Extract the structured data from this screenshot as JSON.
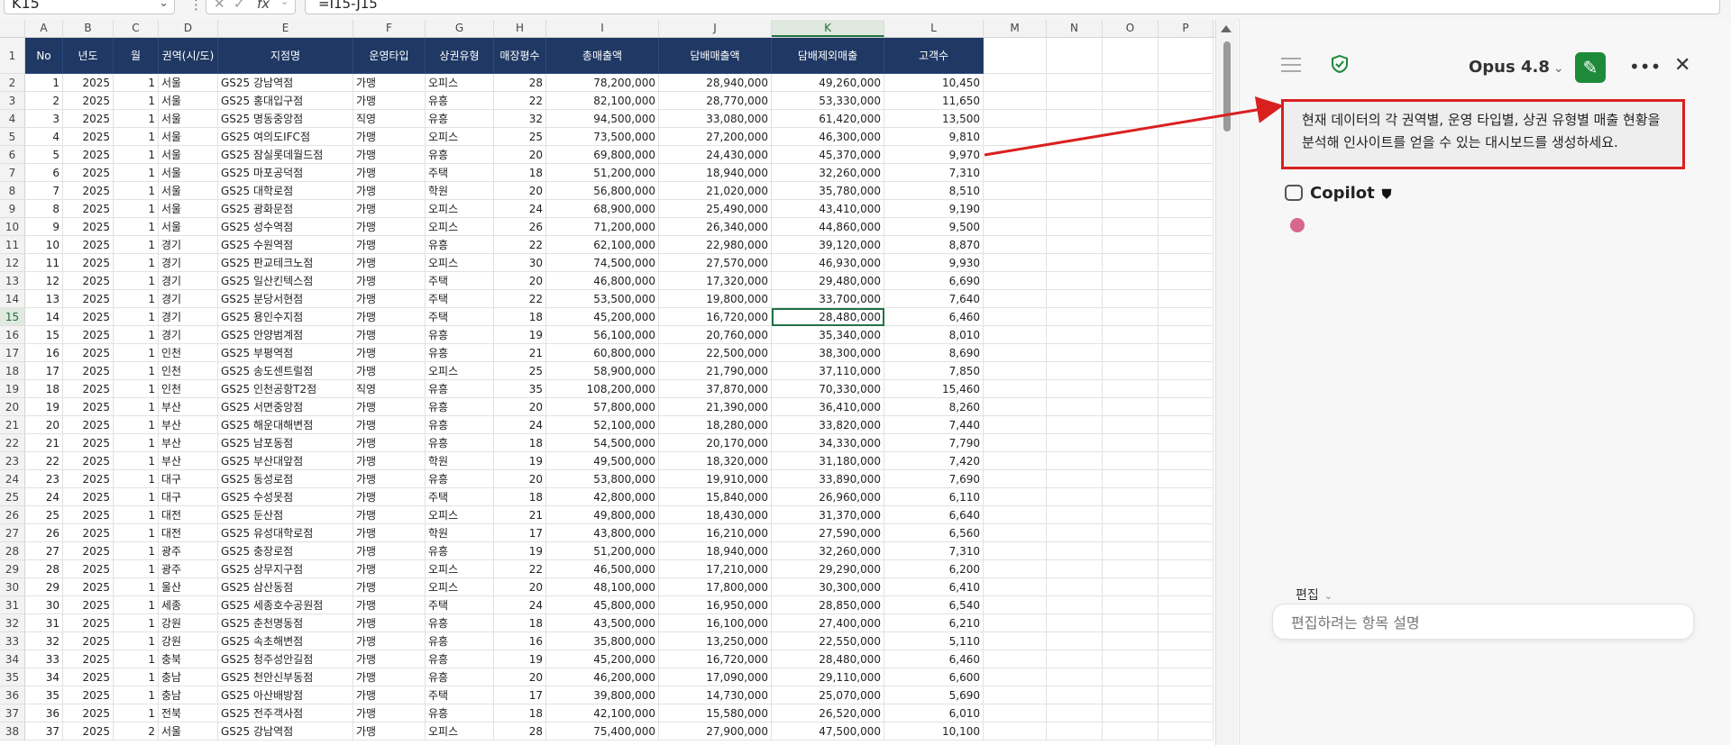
{
  "formula_bar": {
    "name_box": "K15",
    "formula": "=I15-J15"
  },
  "columns": [
    "A",
    "B",
    "C",
    "D",
    "E",
    "F",
    "G",
    "H",
    "I",
    "J",
    "K",
    "L",
    "M",
    "N",
    "O",
    "P"
  ],
  "selected_column": "K",
  "selected_row": "15",
  "table": {
    "headers": [
      "No",
      "년도",
      "월",
      "권역(시/도)",
      "지점명",
      "운영타입",
      "상권유형",
      "매장평수",
      "총매출액",
      "담배매출액",
      "담배제외매출",
      "고객수"
    ],
    "rows": [
      [
        "1",
        "2025",
        "1",
        "서울",
        "GS25 강남역점",
        "가맹",
        "오피스",
        "28",
        "78,200,000",
        "28,940,000",
        "49,260,000",
        "10,450"
      ],
      [
        "2",
        "2025",
        "1",
        "서울",
        "GS25 홍대입구점",
        "가맹",
        "유흥",
        "22",
        "82,100,000",
        "28,770,000",
        "53,330,000",
        "11,650"
      ],
      [
        "3",
        "2025",
        "1",
        "서울",
        "GS25 명동중앙점",
        "직영",
        "유흥",
        "32",
        "94,500,000",
        "33,080,000",
        "61,420,000",
        "13,500"
      ],
      [
        "4",
        "2025",
        "1",
        "서울",
        "GS25 여의도IFC점",
        "가맹",
        "오피스",
        "25",
        "73,500,000",
        "27,200,000",
        "46,300,000",
        "9,810"
      ],
      [
        "5",
        "2025",
        "1",
        "서울",
        "GS25 잠실롯데월드점",
        "가맹",
        "유흥",
        "20",
        "69,800,000",
        "24,430,000",
        "45,370,000",
        "9,970"
      ],
      [
        "6",
        "2025",
        "1",
        "서울",
        "GS25 마포공덕점",
        "가맹",
        "주택",
        "18",
        "51,200,000",
        "18,940,000",
        "32,260,000",
        "7,310"
      ],
      [
        "7",
        "2025",
        "1",
        "서울",
        "GS25 대학로점",
        "가맹",
        "학원",
        "20",
        "56,800,000",
        "21,020,000",
        "35,780,000",
        "8,510"
      ],
      [
        "8",
        "2025",
        "1",
        "서울",
        "GS25 광화문점",
        "가맹",
        "오피스",
        "24",
        "68,900,000",
        "25,490,000",
        "43,410,000",
        "9,190"
      ],
      [
        "9",
        "2025",
        "1",
        "서울",
        "GS25 성수역점",
        "가맹",
        "오피스",
        "26",
        "71,200,000",
        "26,340,000",
        "44,860,000",
        "9,500"
      ],
      [
        "10",
        "2025",
        "1",
        "경기",
        "GS25 수원역점",
        "가맹",
        "유흥",
        "22",
        "62,100,000",
        "22,980,000",
        "39,120,000",
        "8,870"
      ],
      [
        "11",
        "2025",
        "1",
        "경기",
        "GS25 판교테크노점",
        "가맹",
        "오피스",
        "30",
        "74,500,000",
        "27,570,000",
        "46,930,000",
        "9,930"
      ],
      [
        "12",
        "2025",
        "1",
        "경기",
        "GS25 일산킨텍스점",
        "가맹",
        "주택",
        "20",
        "46,800,000",
        "17,320,000",
        "29,480,000",
        "6,690"
      ],
      [
        "13",
        "2025",
        "1",
        "경기",
        "GS25 분당서현점",
        "가맹",
        "주택",
        "22",
        "53,500,000",
        "19,800,000",
        "33,700,000",
        "7,640"
      ],
      [
        "14",
        "2025",
        "1",
        "경기",
        "GS25 용인수지점",
        "가맹",
        "주택",
        "18",
        "45,200,000",
        "16,720,000",
        "28,480,000",
        "6,460"
      ],
      [
        "15",
        "2025",
        "1",
        "경기",
        "GS25 안양범계점",
        "가맹",
        "유흥",
        "19",
        "56,100,000",
        "20,760,000",
        "35,340,000",
        "8,010"
      ],
      [
        "16",
        "2025",
        "1",
        "인천",
        "GS25 부평역점",
        "가맹",
        "유흥",
        "21",
        "60,800,000",
        "22,500,000",
        "38,300,000",
        "8,690"
      ],
      [
        "17",
        "2025",
        "1",
        "인천",
        "GS25 송도센트럴점",
        "가맹",
        "오피스",
        "25",
        "58,900,000",
        "21,790,000",
        "37,110,000",
        "7,850"
      ],
      [
        "18",
        "2025",
        "1",
        "인천",
        "GS25 인천공항T2점",
        "직영",
        "유흥",
        "35",
        "108,200,000",
        "37,870,000",
        "70,330,000",
        "15,460"
      ],
      [
        "19",
        "2025",
        "1",
        "부산",
        "GS25 서면중앙점",
        "가맹",
        "유흥",
        "20",
        "57,800,000",
        "21,390,000",
        "36,410,000",
        "8,260"
      ],
      [
        "20",
        "2025",
        "1",
        "부산",
        "GS25 해운대해변점",
        "가맹",
        "유흥",
        "24",
        "52,100,000",
        "18,280,000",
        "33,820,000",
        "7,440"
      ],
      [
        "21",
        "2025",
        "1",
        "부산",
        "GS25 남포동점",
        "가맹",
        "유흥",
        "18",
        "54,500,000",
        "20,170,000",
        "34,330,000",
        "7,790"
      ],
      [
        "22",
        "2025",
        "1",
        "부산",
        "GS25 부산대앞점",
        "가맹",
        "학원",
        "19",
        "49,500,000",
        "18,320,000",
        "31,180,000",
        "7,420"
      ],
      [
        "23",
        "2025",
        "1",
        "대구",
        "GS25 동성로점",
        "가맹",
        "유흥",
        "20",
        "53,800,000",
        "19,910,000",
        "33,890,000",
        "7,690"
      ],
      [
        "24",
        "2025",
        "1",
        "대구",
        "GS25 수성못점",
        "가맹",
        "주택",
        "18",
        "42,800,000",
        "15,840,000",
        "26,960,000",
        "6,110"
      ],
      [
        "25",
        "2025",
        "1",
        "대전",
        "GS25 둔산점",
        "가맹",
        "오피스",
        "21",
        "49,800,000",
        "18,430,000",
        "31,370,000",
        "6,640"
      ],
      [
        "26",
        "2025",
        "1",
        "대전",
        "GS25 유성대학로점",
        "가맹",
        "학원",
        "17",
        "43,800,000",
        "16,210,000",
        "27,590,000",
        "6,560"
      ],
      [
        "27",
        "2025",
        "1",
        "광주",
        "GS25 충장로점",
        "가맹",
        "유흥",
        "19",
        "51,200,000",
        "18,940,000",
        "32,260,000",
        "7,310"
      ],
      [
        "28",
        "2025",
        "1",
        "광주",
        "GS25 상무지구점",
        "가맹",
        "오피스",
        "22",
        "46,500,000",
        "17,210,000",
        "29,290,000",
        "6,200"
      ],
      [
        "29",
        "2025",
        "1",
        "울산",
        "GS25 삼산동점",
        "가맹",
        "오피스",
        "20",
        "48,100,000",
        "17,800,000",
        "30,300,000",
        "6,410"
      ],
      [
        "30",
        "2025",
        "1",
        "세종",
        "GS25 세종호수공원점",
        "가맹",
        "주택",
        "24",
        "45,800,000",
        "16,950,000",
        "28,850,000",
        "6,540"
      ],
      [
        "31",
        "2025",
        "1",
        "강원",
        "GS25 춘천명동점",
        "가맹",
        "유흥",
        "18",
        "43,500,000",
        "16,100,000",
        "27,400,000",
        "6,210"
      ],
      [
        "32",
        "2025",
        "1",
        "강원",
        "GS25 속초해변점",
        "가맹",
        "유흥",
        "16",
        "35,800,000",
        "13,250,000",
        "22,550,000",
        "5,110"
      ],
      [
        "33",
        "2025",
        "1",
        "충북",
        "GS25 청주성안길점",
        "가맹",
        "유흥",
        "19",
        "45,200,000",
        "16,720,000",
        "28,480,000",
        "6,460"
      ],
      [
        "34",
        "2025",
        "1",
        "충남",
        "GS25 천안신부동점",
        "가맹",
        "유흥",
        "20",
        "46,200,000",
        "17,090,000",
        "29,110,000",
        "6,600"
      ],
      [
        "35",
        "2025",
        "1",
        "충남",
        "GS25 아산배방점",
        "가맹",
        "주택",
        "17",
        "39,800,000",
        "14,730,000",
        "25,070,000",
        "5,690"
      ],
      [
        "36",
        "2025",
        "1",
        "전북",
        "GS25 전주객사점",
        "가맹",
        "유흥",
        "18",
        "42,100,000",
        "15,580,000",
        "26,520,000",
        "6,010"
      ],
      [
        "37",
        "2025",
        "2",
        "서울",
        "GS25 강남역점",
        "가맹",
        "오피스",
        "28",
        "75,400,000",
        "27,900,000",
        "47,500,000",
        "10,100"
      ]
    ]
  },
  "copilot_panel": {
    "model_label": "Opus 4.8",
    "prompt_text": "현재 데이터의 각 권역별, 운영 타입별, 상권 유형별 매출 현황을 분석해 인사이트를 얻을 수 있는 대시보드를 생성하세요.",
    "copilot_label": "Copilot",
    "edit_label": "편집",
    "input_placeholder": "편집하려는 항목 설명"
  },
  "colors": {
    "header_fill": "#1f3864",
    "selection_green": "#217346",
    "highlight_red": "#d9201f",
    "new_chat_green": "#1d8a3a",
    "status_dot_pink": "#d8668f"
  }
}
